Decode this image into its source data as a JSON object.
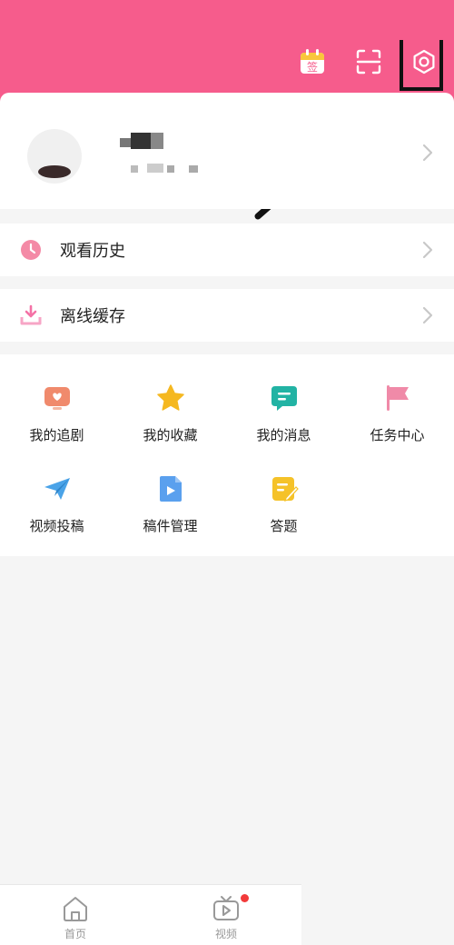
{
  "header": {
    "sign_in_icon_text": "签",
    "icons": [
      "calendar-sign-in-icon",
      "scan-icon",
      "gear-icon"
    ],
    "accent_color": "#f65c8c"
  },
  "menu": {
    "history_label": "观看历史",
    "offline_label": "离线缓存"
  },
  "grid": {
    "items": [
      {
        "label": "我的追剧",
        "icon": "tv-heart-icon",
        "color": "#f08a6c"
      },
      {
        "label": "我的收藏",
        "icon": "star-icon",
        "color": "#f5b820"
      },
      {
        "label": "我的消息",
        "icon": "message-icon",
        "color": "#22b3a4"
      },
      {
        "label": "任务中心",
        "icon": "flag-icon",
        "color": "#f08aa8"
      },
      {
        "label": "视频投稿",
        "icon": "paper-plane-icon",
        "color": "#4aa3e8"
      },
      {
        "label": "稿件管理",
        "icon": "video-file-icon",
        "color": "#5aa0ee"
      },
      {
        "label": "答题",
        "icon": "edit-note-icon",
        "color": "#f5c229"
      }
    ]
  },
  "tabbar": {
    "home_label": "首页",
    "video_label": "视频"
  }
}
